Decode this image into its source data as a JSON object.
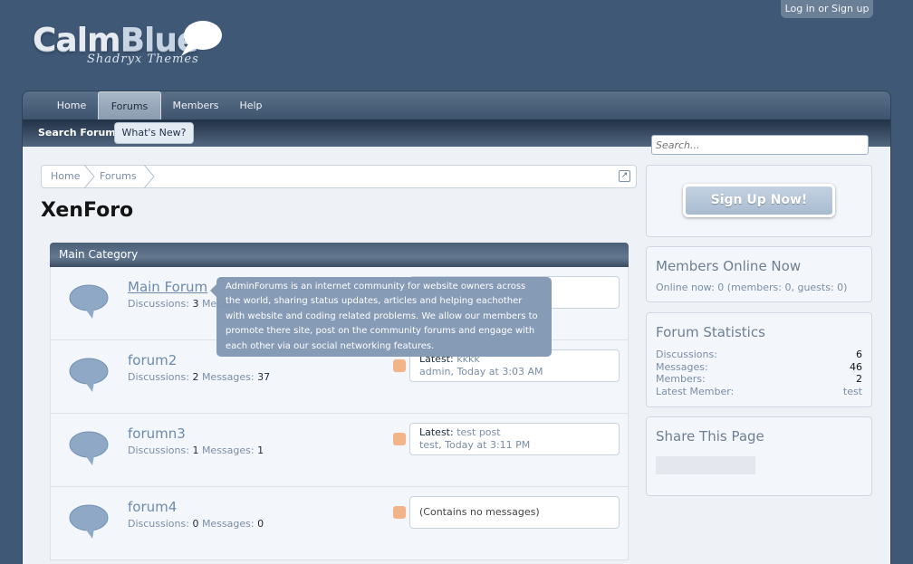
{
  "header": {
    "login_label": "Log in or Sign up",
    "logo_part1": "Calm",
    "logo_part2": "Blue",
    "logo_sub": "Shadryx Themes"
  },
  "nav": {
    "tabs": [
      {
        "label": "Home"
      },
      {
        "label": "Forums"
      },
      {
        "label": "Members"
      },
      {
        "label": "Help"
      }
    ],
    "selected": "Forums",
    "sub_links": [
      {
        "label": "Search Forums"
      },
      {
        "label": "What's New?"
      }
    ]
  },
  "breadcrumb": {
    "items": [
      "Home",
      "Forums"
    ],
    "jump_icon": "external-link-icon"
  },
  "page_title": "XenForo",
  "category": {
    "title": "Main Category",
    "forums": [
      {
        "title": "Main Forum",
        "discussions_label": "Discussions:",
        "discussions": "3",
        "messages_label": "Messag",
        "messages": "",
        "latest_label": "",
        "latest_title": "",
        "latest_meta": ""
      },
      {
        "title": "forum2",
        "discussions_label": "Discussions:",
        "discussions": "2",
        "messages_label": "Messages:",
        "messages": "37",
        "latest_label": "Latest:",
        "latest_title": "kkkk",
        "latest_meta": "admin, Today at 3:03 AM"
      },
      {
        "title": "forumn3",
        "discussions_label": "Discussions:",
        "discussions": "1",
        "messages_label": "Messages:",
        "messages": "1",
        "latest_label": "Latest:",
        "latest_title": "test post",
        "latest_meta": "test, Today at 3:11 PM"
      },
      {
        "title": "forum4",
        "discussions_label": "Discussions:",
        "discussions": "0",
        "messages_label": "Messages:",
        "messages": "0",
        "latest_empty": "(Contains no messages)"
      }
    ]
  },
  "tooltip": {
    "text": "AdminForums is an internet community for website owners across the world, sharing status updates, articles and helping eachother with website and coding related problems. We allow our members to promote there site, post on the community forums and engage with each other via our social networking features."
  },
  "sidebar": {
    "search_placeholder": "Search...",
    "signup_label": "Sign Up Now!",
    "online": {
      "heading": "Members Online Now",
      "text": "Online now: 0 (members: 0, guests: 0)"
    },
    "stats": {
      "heading": "Forum Statistics",
      "rows": [
        {
          "label": "Discussions:",
          "value": "6"
        },
        {
          "label": "Messages:",
          "value": "46"
        },
        {
          "label": "Members:",
          "value": "2"
        },
        {
          "label": "Latest Member:",
          "value": "test"
        }
      ]
    },
    "share": {
      "heading": "Share This Page"
    }
  },
  "colors": {
    "background": "#3f5876",
    "accent": "#6d8aad",
    "tooltip": "#8096b2"
  }
}
